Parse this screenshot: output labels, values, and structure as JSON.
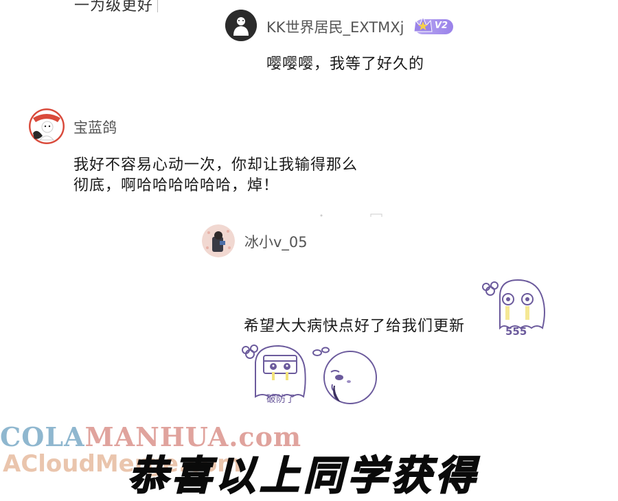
{
  "top_fragment": {
    "text": "一为级更好"
  },
  "comments": [
    {
      "username": "KK世界居民_EXTMXj",
      "vip_level": "V2",
      "text": "嘤嘤嘤，我等了好久的"
    },
    {
      "username": "宝蓝鸽",
      "text_line1": "我好不容易心动一次，你却让我输得那么",
      "text_line2": "彻底，啊哈哈哈哈哈哈，焯！"
    },
    {
      "username": "冰小v_05",
      "text": "希望大大病快点好了给我们更新",
      "sticker1_caption": "555",
      "sticker2_caption": "破防了"
    }
  ],
  "watermark": {
    "line1_part1": "COLA",
    "line1_part2": "MANHUA.com",
    "line2": "ACloudMerge.com"
  },
  "banner": {
    "text": "恭喜以上同学获得"
  },
  "colors": {
    "vip_gradient_start": "#b8a7f1",
    "vip_gradient_end": "#9a82ea",
    "sticker_purple": "#6b5a9c",
    "username_gray": "#555555"
  }
}
